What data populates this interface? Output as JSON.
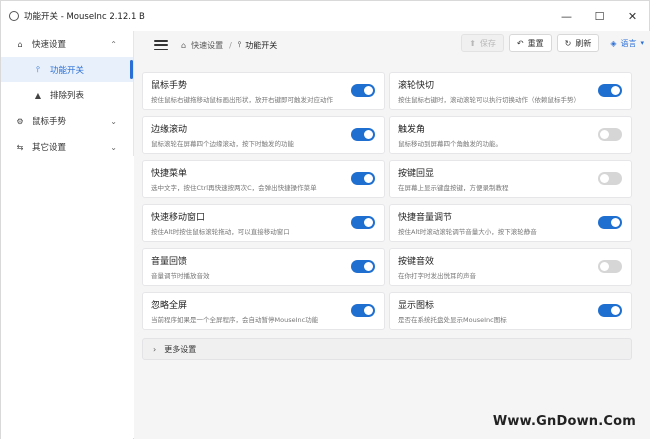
{
  "window": {
    "title": "功能开关 - MouseInc 2.12.1 B",
    "controls": [
      "—",
      "☐",
      "✕"
    ]
  },
  "sidebar": {
    "items": [
      {
        "label": "快速设置",
        "icon": "home-icon",
        "expanded": true
      },
      {
        "label": "功能开关",
        "icon": "pin-icon",
        "active": true
      },
      {
        "label": "排除列表",
        "icon": "warning-icon"
      },
      {
        "label": "鼠标手势",
        "icon": "gear-icon",
        "expanded": false
      },
      {
        "label": "其它设置",
        "icon": "sliders-icon",
        "expanded": false
      }
    ]
  },
  "toolbar": {
    "breadcrumb": [
      "快速设置",
      "功能开关"
    ],
    "save_label": "保存",
    "reset_label": "重置",
    "refresh_label": "刷新",
    "language_label": "语言"
  },
  "cards": [
    {
      "title": "鼠标手势",
      "desc": "按住鼠标右键拖移动鼠标画出形状，放开右键即可触发对应动作",
      "on": true
    },
    {
      "title": "滚轮快切",
      "desc": "按住鼠标右键时，滚动滚轮可以执行切换动作（依赖鼠标手势）",
      "on": true
    },
    {
      "title": "边缘滚动",
      "desc": "鼠标滚轮在屏幕四个边缘滚动，按下时触发的功能",
      "on": true
    },
    {
      "title": "触发角",
      "desc": "鼠标移动到屏幕四个角触发的功能。",
      "on": false
    },
    {
      "title": "快捷菜单",
      "desc": "选中文字，按住Ctrl再快速按两次C，会弹出快捷操作菜单",
      "on": true
    },
    {
      "title": "按键回显",
      "desc": "在屏幕上显示键盘按键，方便录制教程",
      "on": false
    },
    {
      "title": "快速移动窗口",
      "desc": "按住Alt时按住鼠标滚轮拖动，可以直接移动窗口",
      "on": true
    },
    {
      "title": "快捷音量调节",
      "desc": "按住Alt时滚动滚轮调节音量大小，按下滚轮静音",
      "on": true
    },
    {
      "title": "音量回馈",
      "desc": "音量调节时播放音效",
      "on": true
    },
    {
      "title": "按键音效",
      "desc": "在你打字时发出悦耳的声音",
      "on": false
    },
    {
      "title": "忽略全屏",
      "desc": "当前程序如果是一个全屏程序，会自动暂停MouseInc功能",
      "on": true
    },
    {
      "title": "显示图标",
      "desc": "是否在系统托盘处显示MouseInc图标",
      "on": true
    }
  ],
  "more_settings_label": "更多设置",
  "watermark": "Www.GnDown.Com",
  "colors": {
    "accent": "#1f6fd1",
    "toggle_off": "#d6d6d6",
    "active_bg": "#e8f0fb"
  }
}
